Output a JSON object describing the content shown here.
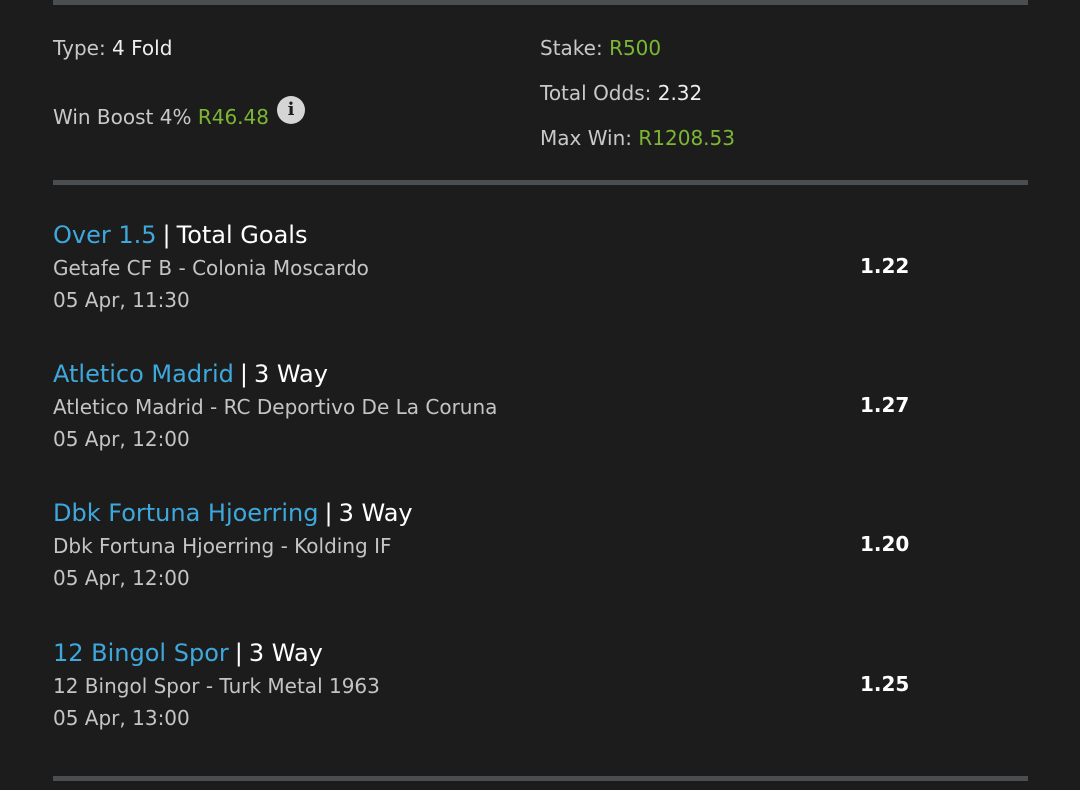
{
  "summary": {
    "type_label": "Type: ",
    "type_value": "4 Fold",
    "boost_label": "Win Boost 4% ",
    "boost_value": "R46.48",
    "stake_label": "Stake: ",
    "stake_value": "R500",
    "total_odds_label": "Total Odds: ",
    "total_odds_value": "2.32",
    "max_win_label": "Max Win: ",
    "max_win_value": "R1208.53",
    "info_icon": "info-icon",
    "info_glyph": "i"
  },
  "colors": {
    "background": "#1c1c1c",
    "accent_blue": "#3ea8dc",
    "accent_green": "#7cb733",
    "divider": "#4a4e51"
  },
  "selections": [
    {
      "pick": "Over 1.5",
      "separator": "|",
      "market": "Total Goals",
      "match": "Getafe CF B - Colonia Moscardo",
      "date": "05 Apr, 11:30",
      "odds": "1.22"
    },
    {
      "pick": "Atletico Madrid",
      "separator": "|",
      "market": "3 Way",
      "match": "Atletico Madrid - RC Deportivo De La Coruna",
      "date": "05 Apr, 12:00",
      "odds": "1.27"
    },
    {
      "pick": "Dbk Fortuna Hjoerring",
      "separator": "|",
      "market": "3 Way",
      "match": "Dbk Fortuna Hjoerring - Kolding IF",
      "date": "05 Apr, 12:00",
      "odds": "1.20"
    },
    {
      "pick": "12 Bingol Spor",
      "separator": "|",
      "market": "3 Way",
      "match": "12 Bingol Spor - Turk Metal 1963",
      "date": "05 Apr, 13:00",
      "odds": "1.25"
    }
  ]
}
